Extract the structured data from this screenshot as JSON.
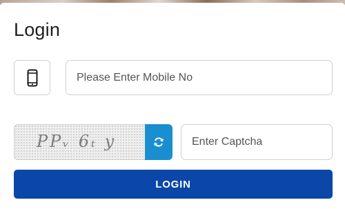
{
  "title": "Login",
  "mobile": {
    "placeholder": "Please Enter Mobile No",
    "value": "",
    "icon": "mobile-phone-icon"
  },
  "captcha": {
    "text": "PPᵥ 6ₜ y",
    "refresh_icon": "refresh-icon",
    "input_placeholder": "Enter Captcha",
    "input_value": ""
  },
  "login_button": {
    "label": "LOGIN"
  },
  "colors": {
    "primary_button": "#0b47a8",
    "refresh_button": "#1a8fd0",
    "border": "#cfcfcf"
  }
}
